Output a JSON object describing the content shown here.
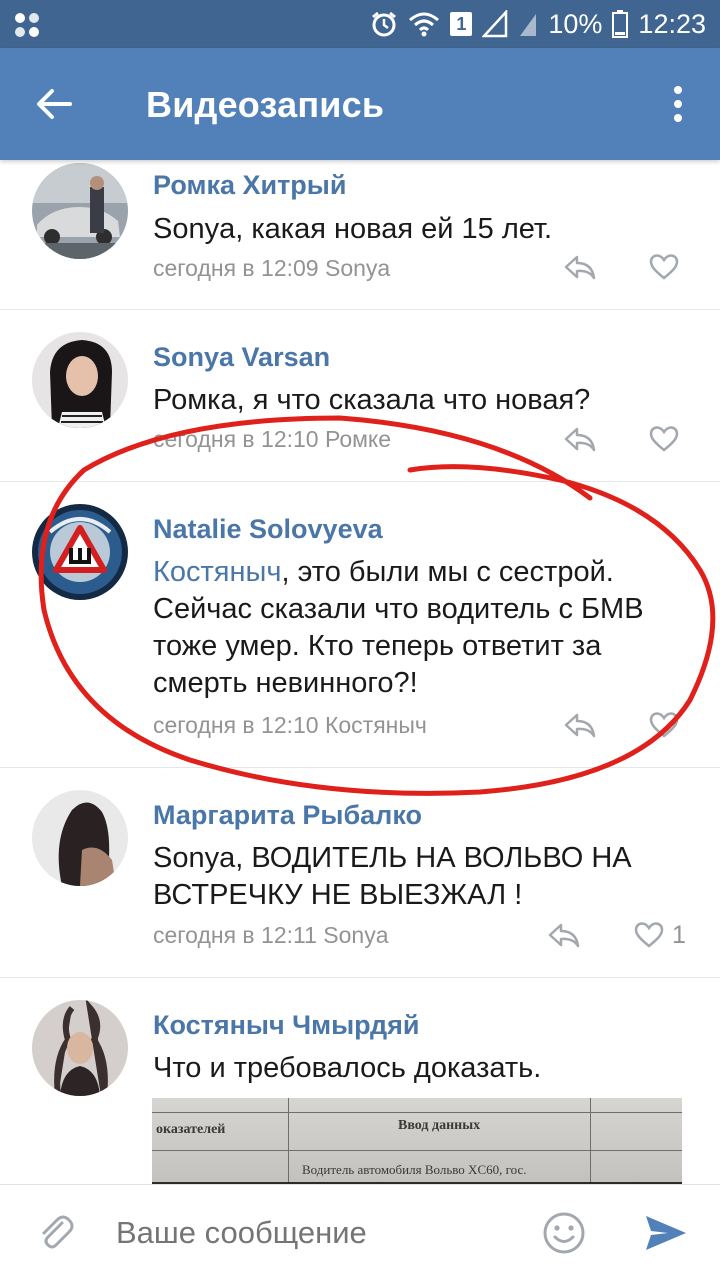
{
  "status_bar": {
    "battery": "10%",
    "time": "12:23",
    "sim_badge": "1"
  },
  "app_bar": {
    "title": "Видеозапись"
  },
  "comments": [
    {
      "author": "Ромка Хитрый",
      "mention": "",
      "text": "Sonya, какая новая ей 15 лет.",
      "meta": "сегодня в 12:09 Sonya",
      "likes": ""
    },
    {
      "author": "Sonya Varsan",
      "mention": "",
      "text": "Ромка, я что сказала что новая?",
      "meta": "сегодня в 12:10 Ромке",
      "likes": ""
    },
    {
      "author": "Natalie Solovyeva",
      "mention": "Костяныч",
      "text": ", это были мы с сестрой. Сейчас сказали что водитель с БМВ тоже умер. Кто теперь ответит за смерть невинного?!",
      "meta": "сегодня в 12:10 Костяныч",
      "likes": ""
    },
    {
      "author": "Маргарита Рыбалко",
      "mention": "",
      "text": "Sonya, ВОДИТЕЛЬ НА ВОЛЬВО НА ВСТРЕЧКУ НЕ ВЫЕЗЖАЛ !",
      "meta": "сегодня в 12:11 Sonya",
      "likes": "1"
    },
    {
      "author": "Костяныч Чмырдяй",
      "mention": "",
      "text": "Что и требовалось доказать.",
      "meta": "",
      "likes": ""
    }
  ],
  "attachment": {
    "col_left": "оказателей",
    "col_right": "Ввод данных",
    "row_text": "Водитель автомобиля Вольво XC60, гос."
  },
  "composer": {
    "placeholder": "Ваше сообщение"
  },
  "colors": {
    "status_bar": "#3f6590",
    "app_bar": "#5181b8",
    "link": "#4a76a8",
    "annotation": "#e0201b"
  },
  "icons": [
    "back-arrow-icon",
    "more-vertical-icon",
    "reply-icon",
    "heart-icon",
    "paperclip-icon",
    "emoji-icon",
    "send-icon",
    "alarm-icon",
    "wifi-icon",
    "signal-icon",
    "battery-icon"
  ]
}
